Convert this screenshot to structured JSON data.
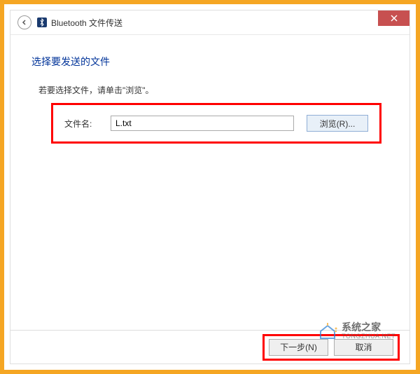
{
  "titlebar": {
    "title": "Bluetooth 文件传送"
  },
  "content": {
    "heading": "选择要发送的文件",
    "instruction": "若要选择文件，请单击\"浏览\"。",
    "file_label": "文件名:",
    "file_value": "L.txt",
    "browse_label": "浏览(R)..."
  },
  "footer": {
    "next_label": "下一步(N)",
    "cancel_label": "取消"
  },
  "watermark": {
    "brand": "系统之家",
    "url": "TONGZHUA.NET"
  }
}
